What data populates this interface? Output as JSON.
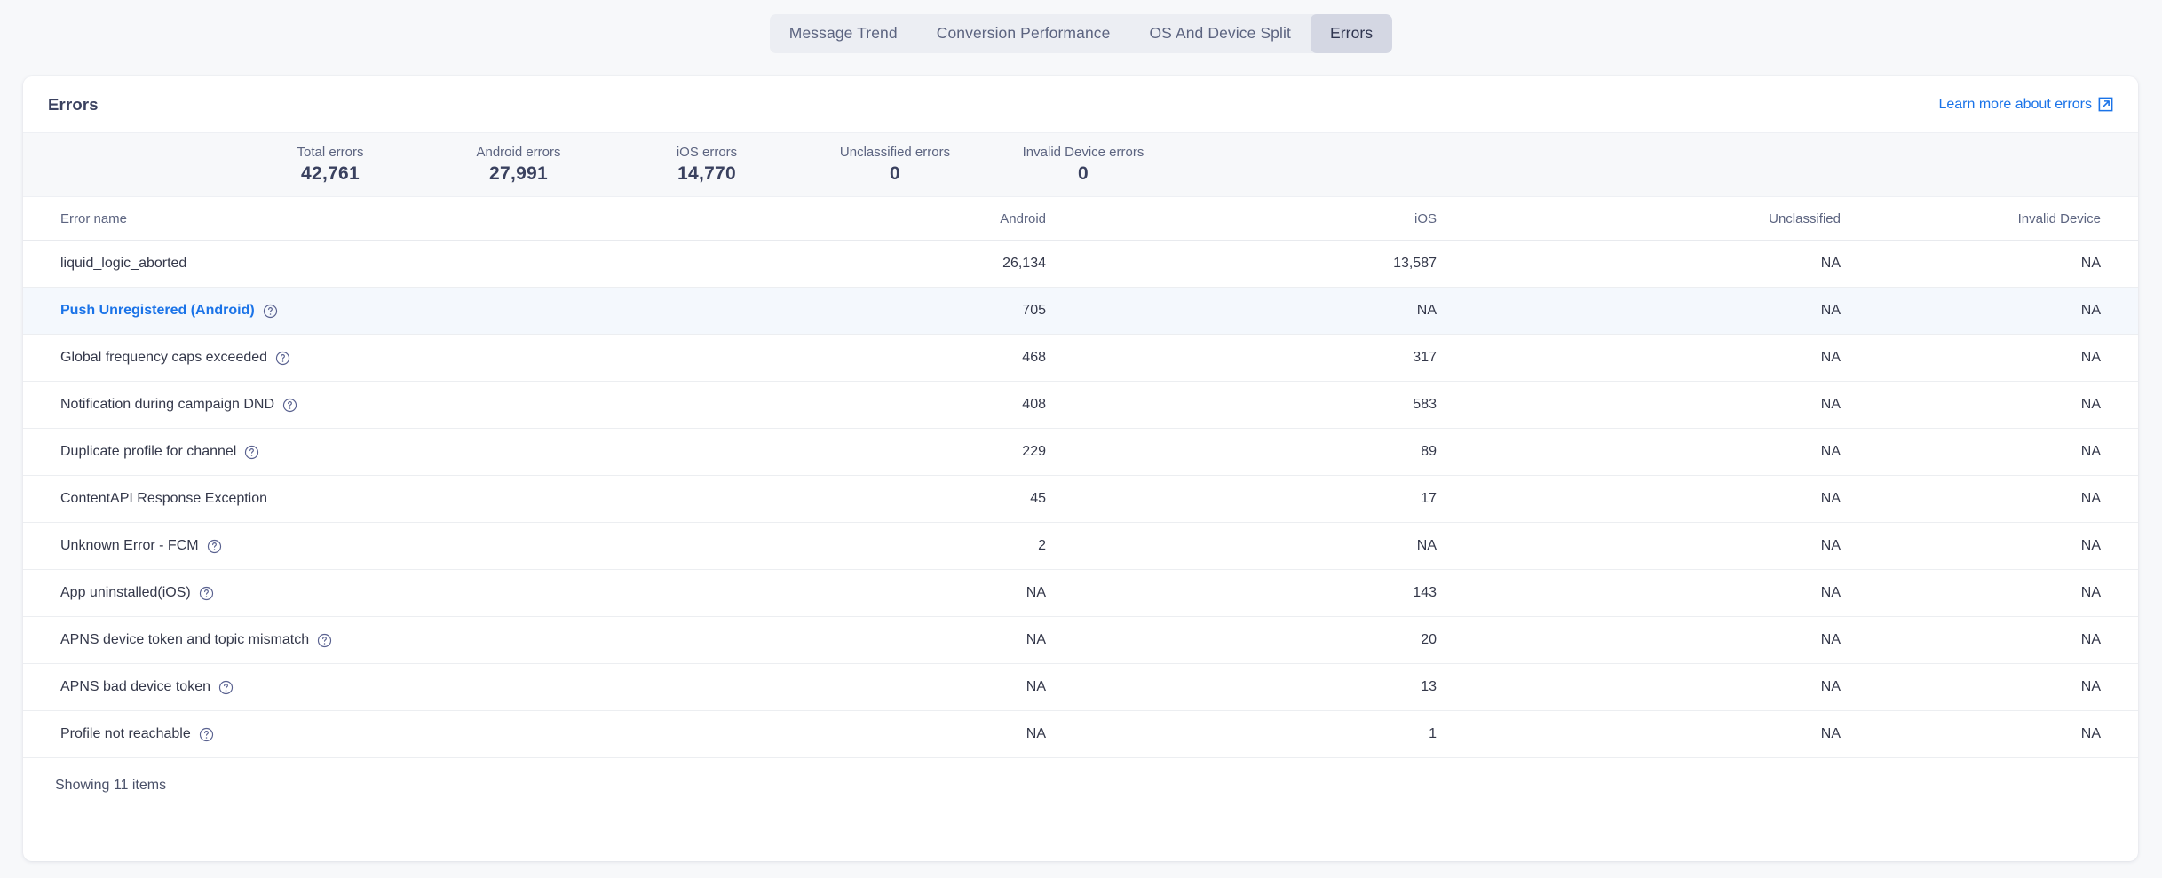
{
  "tabs": [
    {
      "label": "Message Trend",
      "active": false
    },
    {
      "label": "Conversion Performance",
      "active": false
    },
    {
      "label": "OS And Device Split",
      "active": false
    },
    {
      "label": "Errors",
      "active": true
    }
  ],
  "card": {
    "title": "Errors",
    "learn_more_label": "Learn more about errors",
    "learn_more_icon": "external-link-icon",
    "footer_text": "Showing 11 items"
  },
  "colors": {
    "link": "#1a73e8",
    "title": "#3a415f",
    "muted": "#5c6480",
    "tabbar_bg": "#eceef3",
    "tab_active_bg": "#d4d7e3",
    "row_highlight_bg": "#f4f8fd",
    "stats_bg": "#f7f8fa"
  },
  "stats": [
    {
      "label": "Total errors",
      "value": "42,761"
    },
    {
      "label": "Android errors",
      "value": "27,991"
    },
    {
      "label": "iOS errors",
      "value": "14,770"
    },
    {
      "label": "Unclassified errors",
      "value": "0"
    },
    {
      "label": "Invalid Device errors",
      "value": "0"
    }
  ],
  "table": {
    "columns": [
      {
        "key": "name",
        "label": "Error name"
      },
      {
        "key": "android",
        "label": "Android"
      },
      {
        "key": "ios",
        "label": "iOS"
      },
      {
        "key": "unclassified",
        "label": "Unclassified"
      },
      {
        "key": "invalid_device",
        "label": "Invalid Device"
      }
    ],
    "rows": [
      {
        "name": "liquid_logic_aborted",
        "help": false,
        "highlight": false,
        "android": "26,134",
        "ios": "13,587",
        "unclassified": "NA",
        "invalid_device": "NA"
      },
      {
        "name": "Push Unregistered (Android)",
        "help": true,
        "highlight": true,
        "android": "705",
        "ios": "NA",
        "unclassified": "NA",
        "invalid_device": "NA"
      },
      {
        "name": "Global frequency caps exceeded",
        "help": true,
        "highlight": false,
        "android": "468",
        "ios": "317",
        "unclassified": "NA",
        "invalid_device": "NA"
      },
      {
        "name": "Notification during campaign DND",
        "help": true,
        "highlight": false,
        "android": "408",
        "ios": "583",
        "unclassified": "NA",
        "invalid_device": "NA"
      },
      {
        "name": "Duplicate profile for channel",
        "help": true,
        "highlight": false,
        "android": "229",
        "ios": "89",
        "unclassified": "NA",
        "invalid_device": "NA"
      },
      {
        "name": "ContentAPI Response Exception",
        "help": false,
        "highlight": false,
        "android": "45",
        "ios": "17",
        "unclassified": "NA",
        "invalid_device": "NA"
      },
      {
        "name": "Unknown Error - FCM",
        "help": true,
        "highlight": false,
        "android": "2",
        "ios": "NA",
        "unclassified": "NA",
        "invalid_device": "NA"
      },
      {
        "name": "App uninstalled(iOS)",
        "help": true,
        "highlight": false,
        "android": "NA",
        "ios": "143",
        "unclassified": "NA",
        "invalid_device": "NA"
      },
      {
        "name": "APNS device token and topic mismatch",
        "help": true,
        "highlight": false,
        "android": "NA",
        "ios": "20",
        "unclassified": "NA",
        "invalid_device": "NA"
      },
      {
        "name": "APNS bad device token",
        "help": true,
        "highlight": false,
        "android": "NA",
        "ios": "13",
        "unclassified": "NA",
        "invalid_device": "NA"
      },
      {
        "name": "Profile not reachable",
        "help": true,
        "highlight": false,
        "android": "NA",
        "ios": "1",
        "unclassified": "NA",
        "invalid_device": "NA"
      }
    ]
  }
}
